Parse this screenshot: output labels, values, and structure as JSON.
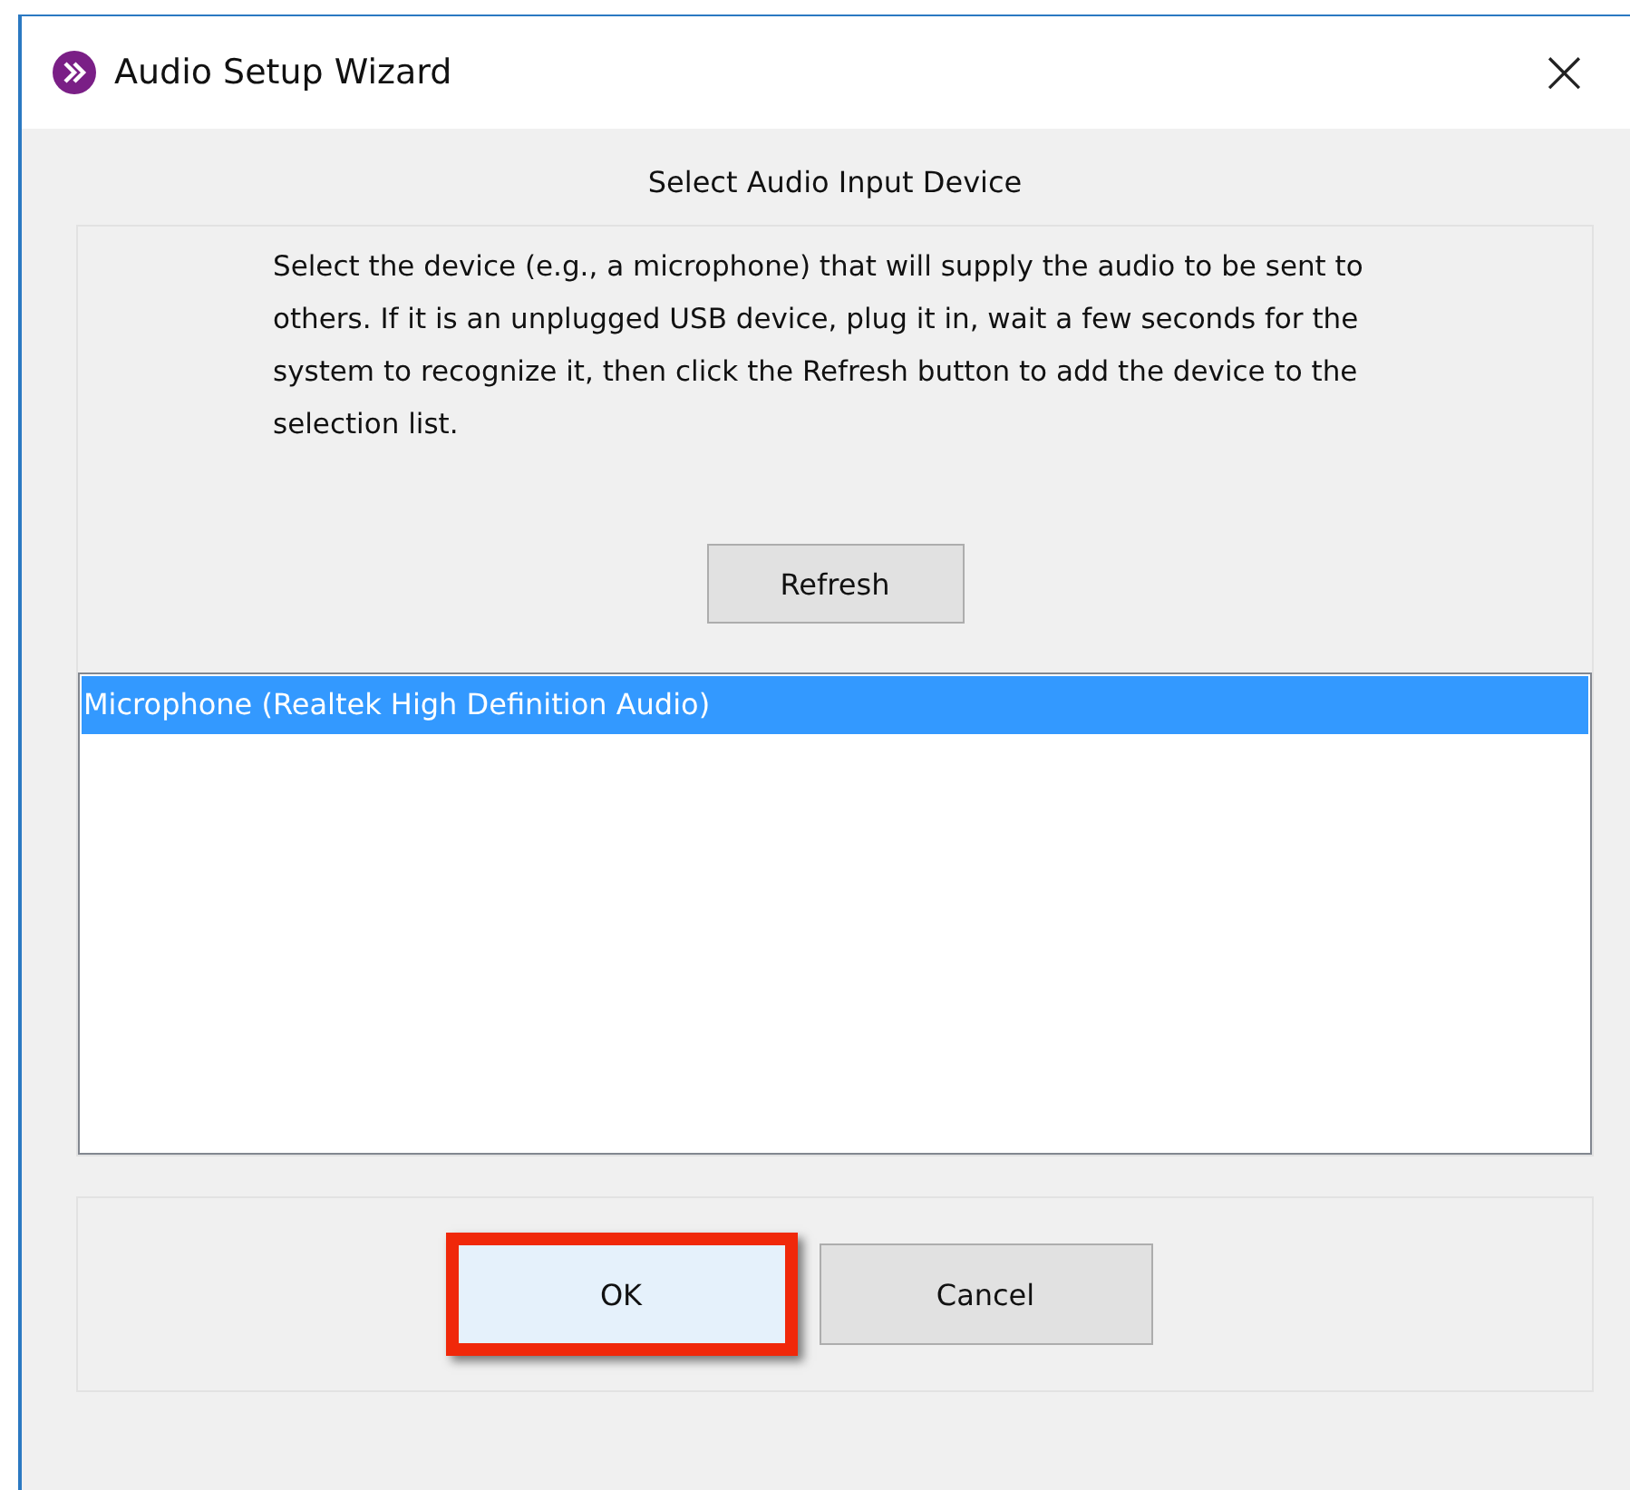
{
  "window": {
    "title": "Audio Setup Wizard",
    "close": "×"
  },
  "heading": "Select Audio Input Device",
  "description": "Select the device (e.g., a microphone) that will supply the audio to be sent to others. If it is an unplugged USB device, plug it in, wait a few seconds for the system to recognize it, then click the Refresh button to add the device to the selection list.",
  "refresh_button": "Refresh",
  "devices": [
    {
      "label": "Microphone (Realtek High Definition Audio)",
      "selected": true
    }
  ],
  "buttons": [
    {
      "label": "OK",
      "highlighted": true
    },
    {
      "label": "Cancel",
      "highlighted": false
    }
  ]
}
